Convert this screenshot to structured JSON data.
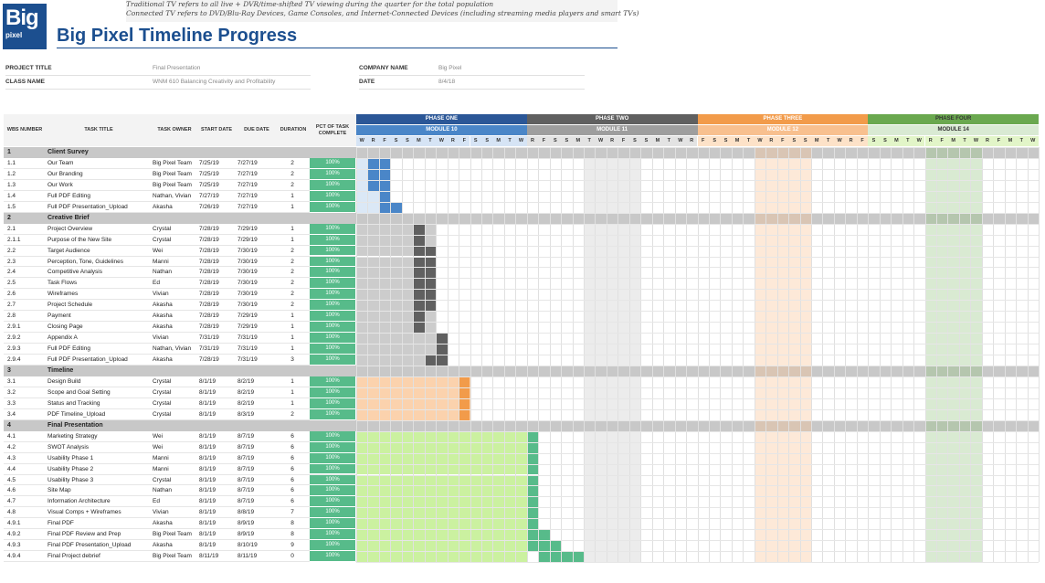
{
  "logo": {
    "text": "Big",
    "sub": "pixel"
  },
  "notes": [
    "Traditional TV refers to all live + DVR/time-shifted TV viewing during the quarter for the total population",
    "Connected TV refers to DVD/Blu-Ray Devices, Game Consoles, and Internet-Connected Devices (including streaming media players and smart TVs)"
  ],
  "title": "Big Pixel Timeline Progress",
  "info": {
    "project_title_label": "PROJECT TITLE",
    "project_title": "Final Presentation",
    "class_name_label": "CLASS NAME",
    "class_name": "WNM 610 Balancing Creativity and Profitability",
    "company_name_label": "COMPANY NAME",
    "company_name": "Big Pixel",
    "date_label": "DATE",
    "date": "8/4/18"
  },
  "columns": {
    "wbs": "WBS NUMBER",
    "task": "TASK TITLE",
    "owner": "TASK OWNER",
    "start": "START DATE",
    "due": "DUE DATE",
    "duration": "DURATION",
    "pct": "PCT OF TASK COMPLETE"
  },
  "phases": [
    {
      "label": "PHASE ONE",
      "module": "MODULE 10"
    },
    {
      "label": "PHASE TWO",
      "module": "MODULE 11"
    },
    {
      "label": "PHASE THREE",
      "module": "MODULE 12"
    },
    {
      "label": "PHASE FOUR",
      "module": "MODULE 14"
    }
  ],
  "days": "W R F S S M T W R F S S M T W R F S S M T W R F S S M T W R F S S M T W R F S S M T W R F S S M T W R F M T W R F M T W R F M T W R F",
  "sections": [
    {
      "wbs": "1",
      "title": "Client Survey",
      "rows": [
        {
          "wbs": "1.1",
          "task": "Our Team",
          "owner": "Big Pixel Team",
          "start": "7/25/19",
          "due": "7/27/19",
          "dur": "2",
          "pct": "100%",
          "bar": [
            1,
            2
          ]
        },
        {
          "wbs": "1.2",
          "task": "Our Branding",
          "owner": "Big Pixel Team",
          "start": "7/25/19",
          "due": "7/27/19",
          "dur": "2",
          "pct": "100%",
          "bar": [
            1,
            2
          ]
        },
        {
          "wbs": "1.3",
          "task": "Our Work",
          "owner": "Big Pixel Team",
          "start": "7/25/19",
          "due": "7/27/19",
          "dur": "2",
          "pct": "100%",
          "bar": [
            1,
            2
          ]
        },
        {
          "wbs": "1.4",
          "task": "Full PDF Editing",
          "owner": "Nathan, Vivian",
          "start": "7/27/19",
          "due": "7/27/19",
          "dur": "1",
          "pct": "100%",
          "bar": [
            2,
            1
          ]
        },
        {
          "wbs": "1.5",
          "task": "Full PDF Presentation_Upload",
          "owner": "Akasha",
          "start": "7/26/19",
          "due": "7/27/19",
          "dur": "1",
          "pct": "100%",
          "bar": [
            2,
            2
          ]
        }
      ]
    },
    {
      "wbs": "2",
      "title": "Creative Brief",
      "rows": [
        {
          "wbs": "2.1",
          "task": "Project Overview",
          "owner": "Crystal",
          "start": "7/28/19",
          "due": "7/29/19",
          "dur": "1",
          "pct": "100%",
          "bar": [
            5,
            1
          ]
        },
        {
          "wbs": "2.1.1",
          "task": "Purpose of the New Site",
          "owner": "Crystal",
          "start": "7/28/19",
          "due": "7/29/19",
          "dur": "1",
          "pct": "100%",
          "bar": [
            5,
            1
          ]
        },
        {
          "wbs": "2.2",
          "task": "Target Audience",
          "owner": "Wei",
          "start": "7/28/19",
          "due": "7/30/19",
          "dur": "2",
          "pct": "100%",
          "bar": [
            5,
            2
          ]
        },
        {
          "wbs": "2.3",
          "task": "Perception, Tone, Guidelines",
          "owner": "Manni",
          "start": "7/28/19",
          "due": "7/30/19",
          "dur": "2",
          "pct": "100%",
          "bar": [
            5,
            2
          ]
        },
        {
          "wbs": "2.4",
          "task": "Competitive Analysis",
          "owner": "Nathan",
          "start": "7/28/19",
          "due": "7/30/19",
          "dur": "2",
          "pct": "100%",
          "bar": [
            5,
            2
          ]
        },
        {
          "wbs": "2.5",
          "task": "Task Flows",
          "owner": "Ed",
          "start": "7/28/19",
          "due": "7/30/19",
          "dur": "2",
          "pct": "100%",
          "bar": [
            5,
            2
          ]
        },
        {
          "wbs": "2.6",
          "task": "Wireframes",
          "owner": "Vivian",
          "start": "7/28/19",
          "due": "7/30/19",
          "dur": "2",
          "pct": "100%",
          "bar": [
            5,
            2
          ]
        },
        {
          "wbs": "2.7",
          "task": "Project Schedule",
          "owner": "Akasha",
          "start": "7/28/19",
          "due": "7/30/19",
          "dur": "2",
          "pct": "100%",
          "bar": [
            5,
            2
          ]
        },
        {
          "wbs": "2.8",
          "task": "Payment",
          "owner": "Akasha",
          "start": "7/28/19",
          "due": "7/29/19",
          "dur": "1",
          "pct": "100%",
          "bar": [
            5,
            1
          ]
        },
        {
          "wbs": "2.9.1",
          "task": "Closing Page",
          "owner": "Akasha",
          "start": "7/28/19",
          "due": "7/29/19",
          "dur": "1",
          "pct": "100%",
          "bar": [
            5,
            1
          ]
        },
        {
          "wbs": "2.9.2",
          "task": "Appendix A",
          "owner": "Vivian",
          "start": "7/31/19",
          "due": "7/31/19",
          "dur": "1",
          "pct": "100%",
          "bar": [
            7,
            1
          ]
        },
        {
          "wbs": "2.9.3",
          "task": "Full PDF Editing",
          "owner": "Nathan, Vivian",
          "start": "7/31/19",
          "due": "7/31/19",
          "dur": "1",
          "pct": "100%",
          "bar": [
            7,
            1
          ]
        },
        {
          "wbs": "2.9.4",
          "task": "Full PDF Presentation_Upload",
          "owner": "Akasha",
          "start": "7/28/19",
          "due": "7/31/19",
          "dur": "3",
          "pct": "100%",
          "bar": [
            6,
            2
          ]
        }
      ]
    },
    {
      "wbs": "3",
      "title": "Timeline",
      "rows": [
        {
          "wbs": "3.1",
          "task": "Design Build",
          "owner": "Crystal",
          "start": "8/1/19",
          "due": "8/2/19",
          "dur": "1",
          "pct": "100%",
          "bar": [
            9,
            1
          ]
        },
        {
          "wbs": "3.2",
          "task": "Scope and Goal Setting",
          "owner": "Crystal",
          "start": "8/1/19",
          "due": "8/2/19",
          "dur": "1",
          "pct": "100%",
          "bar": [
            9,
            1
          ]
        },
        {
          "wbs": "3.3",
          "task": "Status and Tracking",
          "owner": "Crystal",
          "start": "8/1/19",
          "due": "8/2/19",
          "dur": "1",
          "pct": "100%",
          "bar": [
            9,
            1
          ]
        },
        {
          "wbs": "3.4",
          "task": "PDF Timeline_Upload",
          "owner": "Crystal",
          "start": "8/1/19",
          "due": "8/3/19",
          "dur": "2",
          "pct": "100%",
          "bar": [
            9,
            1
          ]
        }
      ]
    },
    {
      "wbs": "4",
      "title": "Final Presentation",
      "rows": [
        {
          "wbs": "4.1",
          "task": "Marketing Strategy",
          "owner": "Wei",
          "start": "8/1/19",
          "due": "8/7/19",
          "dur": "6",
          "pct": "100%",
          "bar": [
            15,
            1
          ]
        },
        {
          "wbs": "4.2",
          "task": "SWOT Analysis",
          "owner": "Wei",
          "start": "8/1/19",
          "due": "8/7/19",
          "dur": "6",
          "pct": "100%",
          "bar": [
            15,
            1
          ]
        },
        {
          "wbs": "4.3",
          "task": "Usability Phase 1",
          "owner": "Manni",
          "start": "8/1/19",
          "due": "8/7/19",
          "dur": "6",
          "pct": "100%",
          "bar": [
            15,
            1
          ]
        },
        {
          "wbs": "4.4",
          "task": "Usability Phase 2",
          "owner": "Manni",
          "start": "8/1/19",
          "due": "8/7/19",
          "dur": "6",
          "pct": "100%",
          "bar": [
            15,
            1
          ]
        },
        {
          "wbs": "4.5",
          "task": "Usability Phase 3",
          "owner": "Crystal",
          "start": "8/1/19",
          "due": "8/7/19",
          "dur": "6",
          "pct": "100%",
          "bar": [
            15,
            1
          ]
        },
        {
          "wbs": "4.6",
          "task": "Site Map",
          "owner": "Nathan",
          "start": "8/1/19",
          "due": "8/7/19",
          "dur": "6",
          "pct": "100%",
          "bar": [
            15,
            1
          ]
        },
        {
          "wbs": "4.7",
          "task": "Information Architecture",
          "owner": "Ed",
          "start": "8/1/19",
          "due": "8/7/19",
          "dur": "6",
          "pct": "100%",
          "bar": [
            15,
            1
          ]
        },
        {
          "wbs": "4.8",
          "task": "Visual Comps + Wireframes",
          "owner": "Vivian",
          "start": "8/1/19",
          "due": "8/8/19",
          "dur": "7",
          "pct": "100%",
          "bar": [
            15,
            1
          ]
        },
        {
          "wbs": "4.9.1",
          "task": "Final PDF",
          "owner": "Akasha",
          "start": "8/1/19",
          "due": "8/9/19",
          "dur": "8",
          "pct": "100%",
          "bar": [
            15,
            1
          ]
        },
        {
          "wbs": "4.9.2",
          "task": "Final PDF Review and Prep",
          "owner": "Big Pixel Team",
          "start": "8/1/19",
          "due": "8/9/19",
          "dur": "8",
          "pct": "100%",
          "bar": [
            15,
            2
          ]
        },
        {
          "wbs": "4.9.3",
          "task": "Final PDF Presentation_Upload",
          "owner": "Akasha",
          "start": "8/1/19",
          "due": "8/10/19",
          "dur": "9",
          "pct": "100%",
          "bar": [
            15,
            3
          ]
        },
        {
          "wbs": "4.9.4",
          "task": "Final Project debrief",
          "owner": "Big Pixel Team",
          "start": "8/11/19",
          "due": "8/11/19",
          "dur": "0",
          "pct": "100%",
          "bar": [
            16,
            4
          ]
        }
      ]
    }
  ],
  "colors": {
    "phase_one": "#2b5797",
    "phase_one_light": "#4a86c8",
    "phase_one_fill": "#dbe8f6",
    "phase_two": "#606060",
    "phase_two_light": "#9e9e9e",
    "phase_two_fill": "#cccccc",
    "phase_three": "#f29b4a",
    "phase_three_light": "#f8c08f",
    "phase_three_fill": "#fbd2ad",
    "phase_four": "#6aa84f",
    "phase_four_light": "#d9ead3",
    "phase_four_fill": "#cbf1a0",
    "pct_green": "#57bb8a",
    "section_gray": "#c8c8c8"
  }
}
